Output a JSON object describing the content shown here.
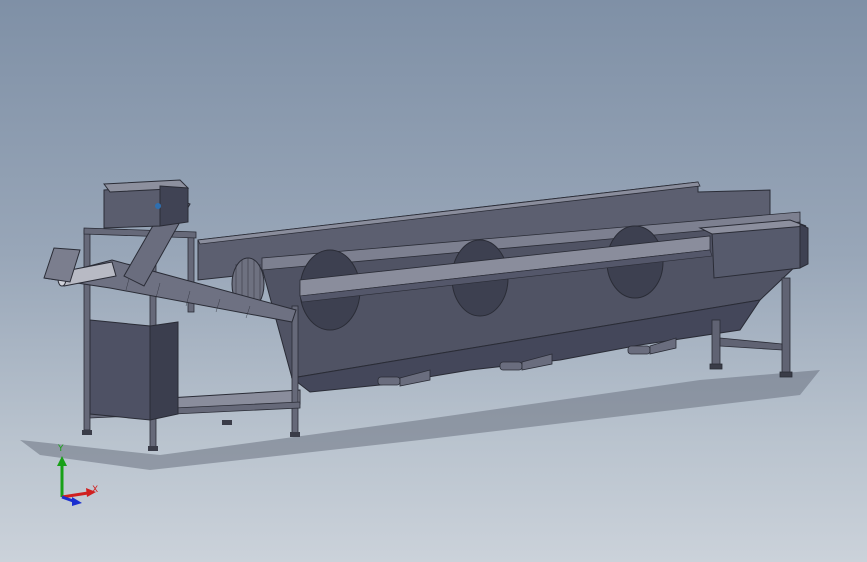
{
  "viewport": {
    "background_top": "#7f90a6",
    "background_bottom": "#cbd2da",
    "model": "washing-conveyor-machine"
  },
  "triad": {
    "x_label": "X",
    "y_label": "Y",
    "x_color": "#d02020",
    "y_color": "#18a018",
    "z_color": "#1a2fd0"
  },
  "colors": {
    "metal_dark": "#4a4d5e",
    "metal_mid": "#5e6172",
    "metal_light": "#7a7d8e",
    "edge": "#2a2c36"
  }
}
